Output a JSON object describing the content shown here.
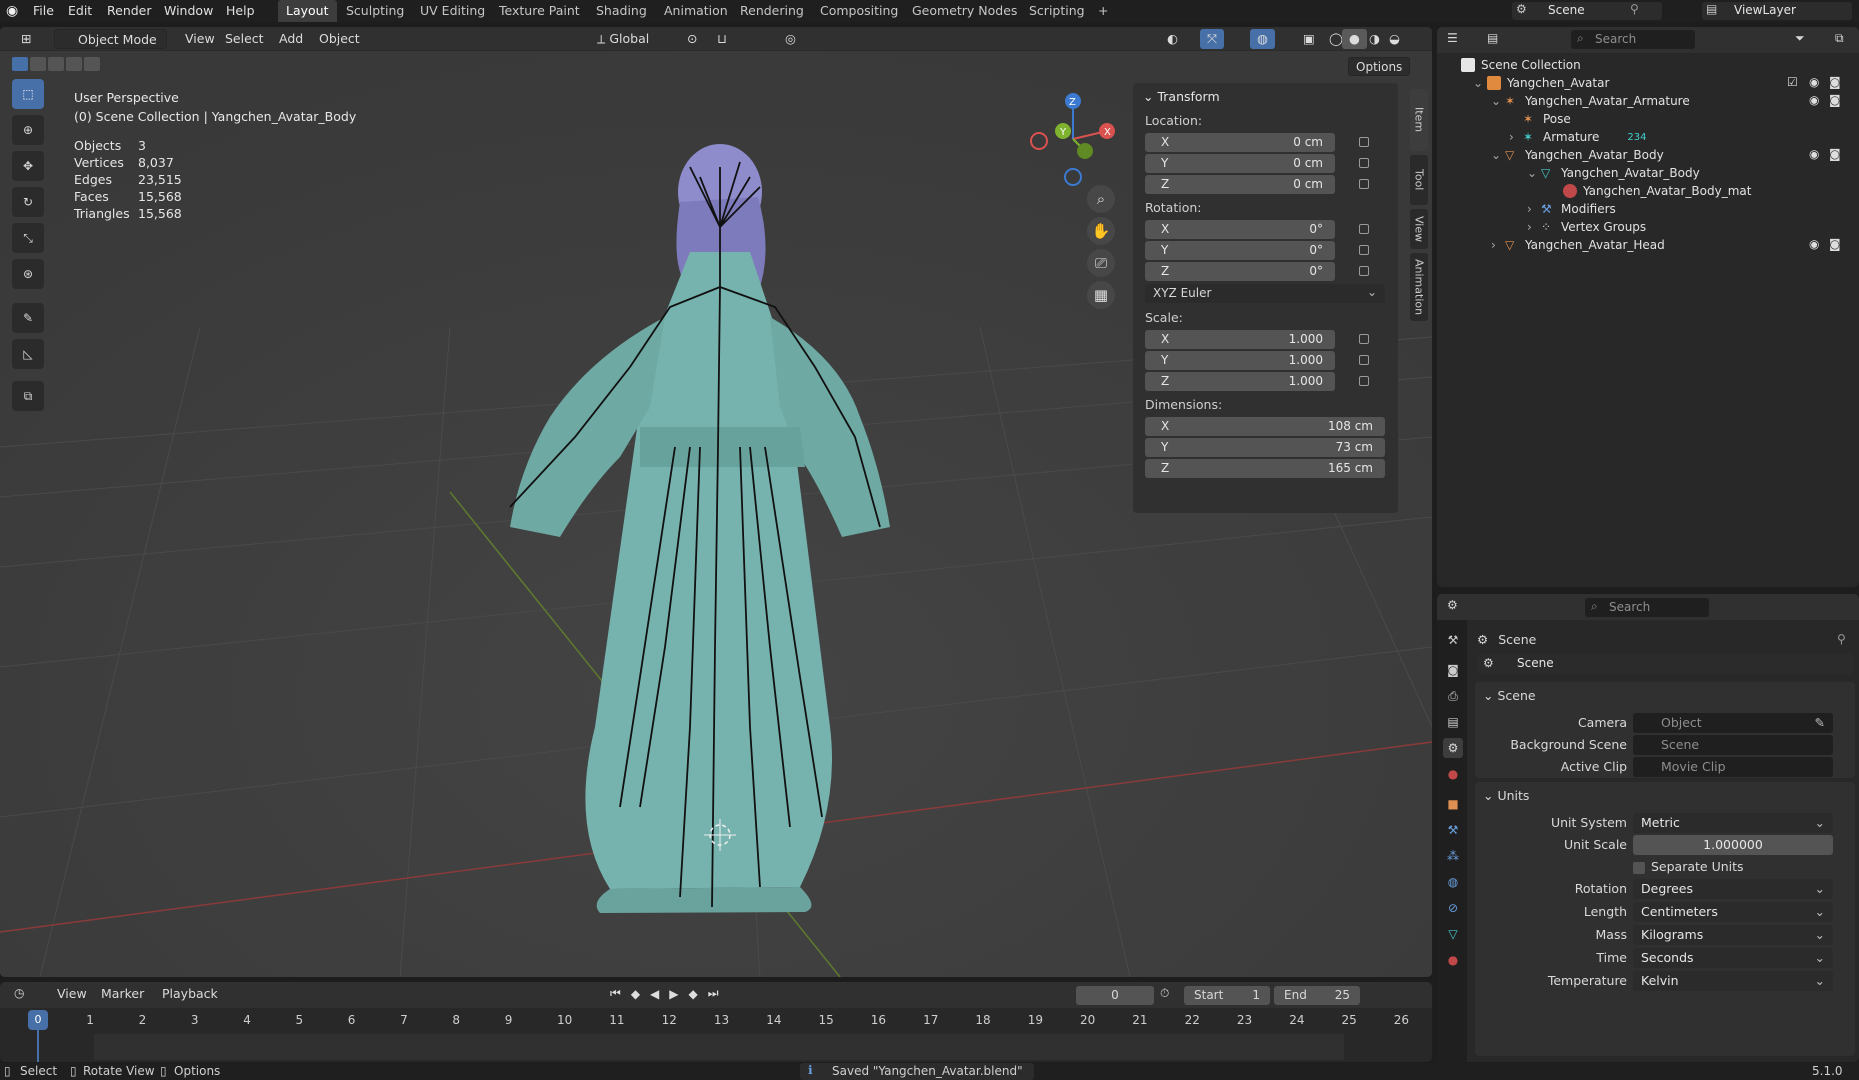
{
  "menu": {
    "items": [
      "File",
      "Edit",
      "Render",
      "Window",
      "Help"
    ]
  },
  "workspaces": {
    "tabs": [
      "Layout",
      "Sculpting",
      "UV Editing",
      "Texture Paint",
      "Shading",
      "Animation",
      "Rendering",
      "Compositing",
      "Geometry Nodes",
      "Scripting",
      "+"
    ],
    "active": "Layout"
  },
  "scene_selector": {
    "label": "Scene",
    "viewlayer": "ViewLayer"
  },
  "viewport": {
    "mode": "Object Mode",
    "menus": [
      "View",
      "Select",
      "Add",
      "Object"
    ],
    "orientation": "Global",
    "options": "Options",
    "overlay_title": "User Perspective",
    "overlay_subtitle": "(0) Scene Collection | Yangchen_Avatar_Body",
    "stats": [
      {
        "label": "Objects",
        "value": "3"
      },
      {
        "label": "Vertices",
        "value": "8,037"
      },
      {
        "label": "Edges",
        "value": "23,515"
      },
      {
        "label": "Faces",
        "value": "15,568"
      },
      {
        "label": "Triangles",
        "value": "15,568"
      }
    ],
    "gizmo": {
      "x": "X",
      "y": "Y",
      "z": "Z"
    },
    "side_tabs": [
      "Item",
      "Tool",
      "View",
      "Animation"
    ]
  },
  "transform_panel": {
    "title": "Transform",
    "location_label": "Location:",
    "location": [
      {
        "axis": "X",
        "value": "0 cm"
      },
      {
        "axis": "Y",
        "value": "0 cm"
      },
      {
        "axis": "Z",
        "value": "0 cm"
      }
    ],
    "rotation_label": "Rotation:",
    "rotation": [
      {
        "axis": "X",
        "value": "0°"
      },
      {
        "axis": "Y",
        "value": "0°"
      },
      {
        "axis": "Z",
        "value": "0°"
      }
    ],
    "rotation_mode": "XYZ Euler",
    "scale_label": "Scale:",
    "scale": [
      {
        "axis": "X",
        "value": "1.000"
      },
      {
        "axis": "Y",
        "value": "1.000"
      },
      {
        "axis": "Z",
        "value": "1.000"
      }
    ],
    "dimensions_label": "Dimensions:",
    "dimensions": [
      {
        "axis": "X",
        "value": "108 cm"
      },
      {
        "axis": "Y",
        "value": "73 cm"
      },
      {
        "axis": "Z",
        "value": "165 cm"
      }
    ]
  },
  "outliner": {
    "search_placeholder": "Search",
    "root": "Scene Collection",
    "items": [
      {
        "label": "Yangchen_Avatar",
        "type": "collection"
      },
      {
        "label": "Yangchen_Avatar_Armature",
        "type": "armature"
      },
      {
        "label": "Pose",
        "type": "pose"
      },
      {
        "label": "Armature",
        "type": "armature-data",
        "badge": "234"
      },
      {
        "label": "Yangchen_Avatar_Body",
        "type": "mesh"
      },
      {
        "label": "Yangchen_Avatar_Body",
        "type": "mesh-data"
      },
      {
        "label": "Yangchen_Avatar_Body_mat",
        "type": "material"
      },
      {
        "label": "Modifiers",
        "type": "modifiers"
      },
      {
        "label": "Vertex Groups",
        "type": "vgroups"
      },
      {
        "label": "Yangchen_Avatar_Head",
        "type": "mesh"
      }
    ]
  },
  "properties": {
    "search_placeholder": "Search",
    "context_label": "Scene",
    "scene_name": "Scene",
    "scene_section": "Scene",
    "camera_label": "Camera",
    "camera_placeholder": "Object",
    "bg_scene_label": "Background Scene",
    "bg_scene_placeholder": "Scene",
    "active_clip_label": "Active Clip",
    "active_clip_placeholder": "Movie Clip",
    "units_section": "Units",
    "unit_system_label": "Unit System",
    "unit_system": "Metric",
    "unit_scale_label": "Unit Scale",
    "unit_scale": "1.000000",
    "separate_units": "Separate Units",
    "rotation_label": "Rotation",
    "rotation": "Degrees",
    "length_label": "Length",
    "length": "Centimeters",
    "mass_label": "Mass",
    "mass": "Kilograms",
    "time_label": "Time",
    "time": "Seconds",
    "temperature_label": "Temperature",
    "temperature": "Kelvin"
  },
  "timeline": {
    "menus": [
      "View",
      "Marker",
      "Playback"
    ],
    "current_frame": "0",
    "start_label": "Start",
    "start": "1",
    "end_label": "End",
    "end": "25",
    "ruler": [
      "0",
      "1",
      "2",
      "3",
      "4",
      "5",
      "6",
      "7",
      "8",
      "9",
      "10",
      "11",
      "12",
      "13",
      "14",
      "15",
      "16",
      "17",
      "18",
      "19",
      "20",
      "21",
      "22",
      "23",
      "24",
      "25",
      "26"
    ]
  },
  "statusbar": {
    "select": "Select",
    "rotate": "Rotate View",
    "options": "Options",
    "message": "Saved \"Yangchen_Avatar.blend\"",
    "version": "5.1.0"
  },
  "colors": {
    "accent": "#476fa8",
    "mesh": "#77b3ae",
    "hair": "#8f8ccc",
    "x_axis": "#d9524f",
    "y_axis": "#7fb22e",
    "z_axis": "#3c7ad1"
  }
}
